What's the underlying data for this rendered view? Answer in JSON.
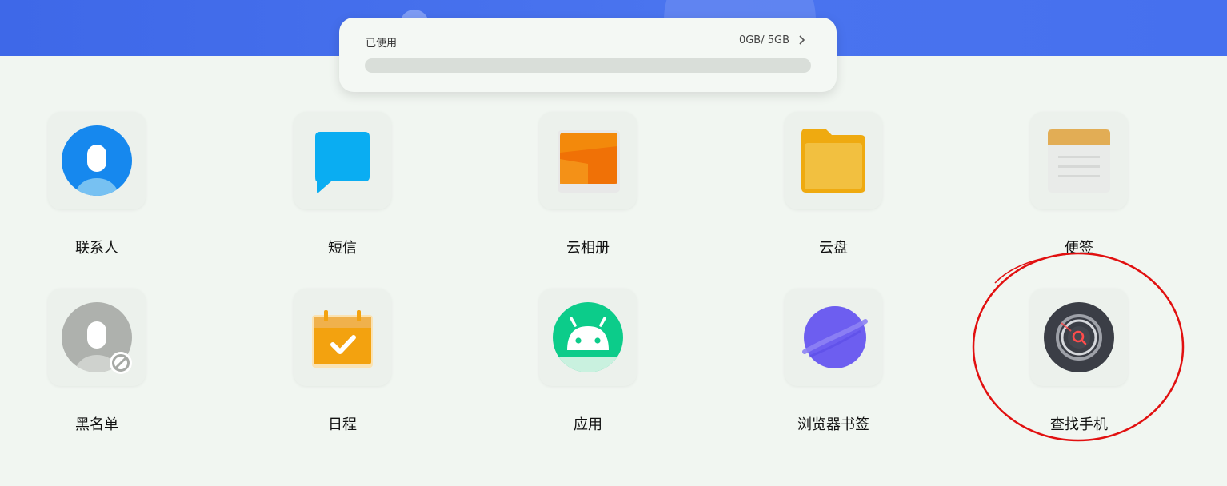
{
  "storage": {
    "label": "已使用",
    "value": "0GB/ 5GB",
    "used_fraction": 0
  },
  "colors": {
    "banner": "#4670ee",
    "background": "#f1f6f1",
    "highlight_circle": "#e11010"
  },
  "apps": [
    {
      "label": "联系人",
      "icon": "contacts-icon"
    },
    {
      "label": "短信",
      "icon": "messages-icon"
    },
    {
      "label": "云相册",
      "icon": "cloud-album-icon"
    },
    {
      "label": "云盘",
      "icon": "cloud-drive-icon"
    },
    {
      "label": "便签",
      "icon": "notes-icon"
    },
    {
      "label": "黑名单",
      "icon": "blacklist-icon"
    },
    {
      "label": "日程",
      "icon": "calendar-icon"
    },
    {
      "label": "应用",
      "icon": "apps-icon"
    },
    {
      "label": "浏览器书签",
      "icon": "browser-bookmarks-icon"
    },
    {
      "label": "查找手机",
      "icon": "find-phone-icon"
    }
  ]
}
